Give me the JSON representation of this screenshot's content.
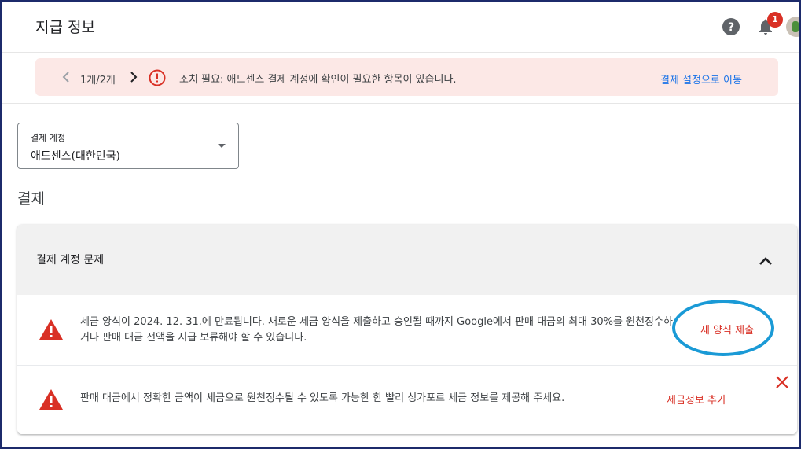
{
  "header": {
    "title": "지급 정보",
    "notification_count": "1"
  },
  "banner": {
    "pager": "1개/2개",
    "message": "조치 필요: 애드센스 결제 계정에 확인이 필요한 항목이 있습니다.",
    "link": "결제 설정으로 이동"
  },
  "account_select": {
    "label": "결제 계정",
    "value": "애드센스(대한민국)"
  },
  "section": {
    "heading": "결제"
  },
  "issues_card": {
    "title": "결제 계정 문제",
    "issues": [
      {
        "text": "세금 양식이 2024. 12. 31.에 만료됩니다. 새로운 세금 양식을 제출하고 승인될 때까지 Google에서 판매 대금의 최대 30%를 원천징수하거나 판매 대금 전액을 지급 보류해야 할 수 있습니다.",
        "action": "새 양식 제출"
      },
      {
        "text": "판매 대금에서 정확한 금액이 세금으로 원천징수될 수 있도록 가능한 한 빨리 싱가포르 세금 정보를 제공해 주세요.",
        "action": "세금정보 추가"
      }
    ]
  },
  "colors": {
    "banner_bg": "#fce8e6",
    "error_red": "#d93025",
    "link_blue": "#1a73e8",
    "highlight_ring": "#1a9ad6"
  },
  "icons": [
    "help-icon",
    "bell-icon",
    "chevron-left-icon",
    "chevron-right-icon",
    "alert-circle-icon",
    "dropdown-arrow-icon",
    "chevron-up-icon",
    "warning-triangle-icon",
    "close-icon"
  ]
}
